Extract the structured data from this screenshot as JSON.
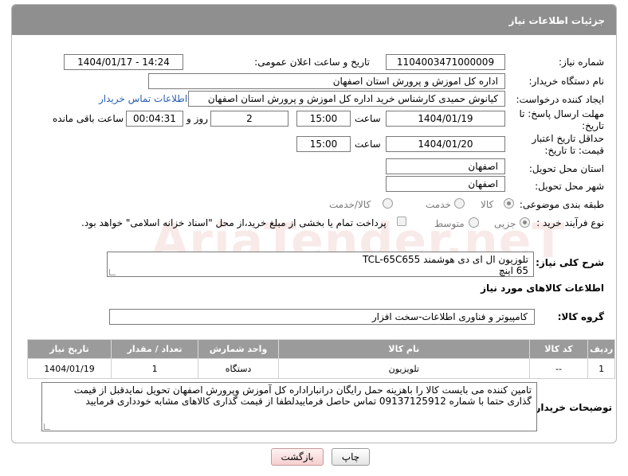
{
  "header": {
    "title": "جزئیات اطلاعات نیاز"
  },
  "labels": {
    "need_number": "شماره نیاز:",
    "announce_datetime": "تاریخ و ساعت اعلان عمومی:",
    "buyer_org": "نام دستگاه خریدار:",
    "requester": "ایجاد کننده درخواست:",
    "reply_deadline": "مهلت ارسال پاسخ: تا تاریخ:",
    "price_validity": "حداقل تاریخ اعتبار قیمت: تا تاریخ:",
    "hour": "ساعت",
    "day_and": "روز و",
    "hours_remaining": "ساعت باقی مانده",
    "delivery_province": "استان محل تحویل:",
    "delivery_city": "شهر محل تحویل:",
    "category": "طبقه بندی موضوعی:",
    "purchase_type": "نوع فرآیند خرید :",
    "general_desc": "شرح کلی نیاز:",
    "goods_info": "اطلاعات کالاهای مورد نیاز",
    "goods_group": "گروه کالا:",
    "buyer_notes": "توضیحات خریدار:"
  },
  "fields": {
    "need_number": "1104003471000009",
    "announce_datetime": "1404/01/17 - 14:24",
    "buyer_org": "اداره کل اموزش و پرورش استان اصفهان",
    "requester": "کیانوش حمیدی کارشناس خرید اداره کل اموزش و پرورش استان اصفهان",
    "contact_link": "اطلاعات تماس خریدار",
    "reply_date": "1404/01/19",
    "reply_time": "15:00",
    "reply_days": "2",
    "reply_remaining": "00:04:31",
    "price_date": "1404/01/20",
    "price_time": "15:00",
    "province": "اصفهان",
    "city": "اصفهان",
    "goods_group": "کامپیوتر و فناوری اطلاعات-سخت افزار"
  },
  "category_options": [
    "کالا",
    "خدمت",
    "کالا/خدمت"
  ],
  "purchase_options": [
    "جزیی",
    "متوسط"
  ],
  "payment_note": "پرداخت تمام یا بخشی از مبلغ خرید،از محل \"اسناد خزانه اسلامی\" خواهد بود.",
  "general_desc_lines": [
    "تلوزیون ال ای دی  هوشمند TCL-65C655",
    "65 اینچ"
  ],
  "table": {
    "headers": [
      "ردیف",
      "کد کالا",
      "نام کالا",
      "واحد شمارش",
      "تعداد / مقدار",
      "تاریخ نیاز"
    ],
    "rows": [
      [
        "1",
        "--",
        "تلویزیون",
        "دستگاه",
        "1",
        "1404/01/19"
      ]
    ]
  },
  "buyer_notes_text": "تامین کننده می بایست کالا را باهزینه حمل رایگان درانباراداره کل آموزش وپرورش  اصفهان تحویل نمایدقبل از قیمت گذاری حتما با شماره 09137125912 تماس حاصل فرماییدلطفا از قیمت گذاری کالاهای مشابه خودداری فرمایید",
  "buttons": {
    "print": "چاپ",
    "back": "بازگشت"
  },
  "watermark": "AriaTender.neT"
}
